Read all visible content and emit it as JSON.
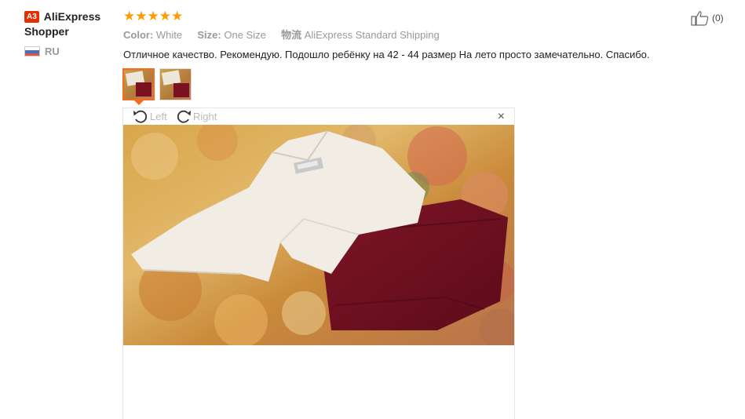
{
  "user": {
    "badge": "A3",
    "name_line1": "AliExpress",
    "name_line2": "Shopper",
    "country": "RU"
  },
  "review": {
    "stars": "★★★★★",
    "color_label": "Color:",
    "color_value": "White",
    "size_label": "Size:",
    "size_value": "One Size",
    "shipping_label": "物流",
    "shipping_value": "AliExpress Standard Shipping",
    "comment": "Отличное качество. Рекомендую. Подошло ребёнку на 42 - 44 размер На лето просто замечательно. Спасибо."
  },
  "viewer": {
    "left_label": "Left",
    "right_label": "Right",
    "close": "×"
  },
  "like": {
    "count": "(0)"
  },
  "colors": {
    "star": "#ff9a00",
    "accent": "#f56b1f",
    "badge": "#e62e04"
  }
}
